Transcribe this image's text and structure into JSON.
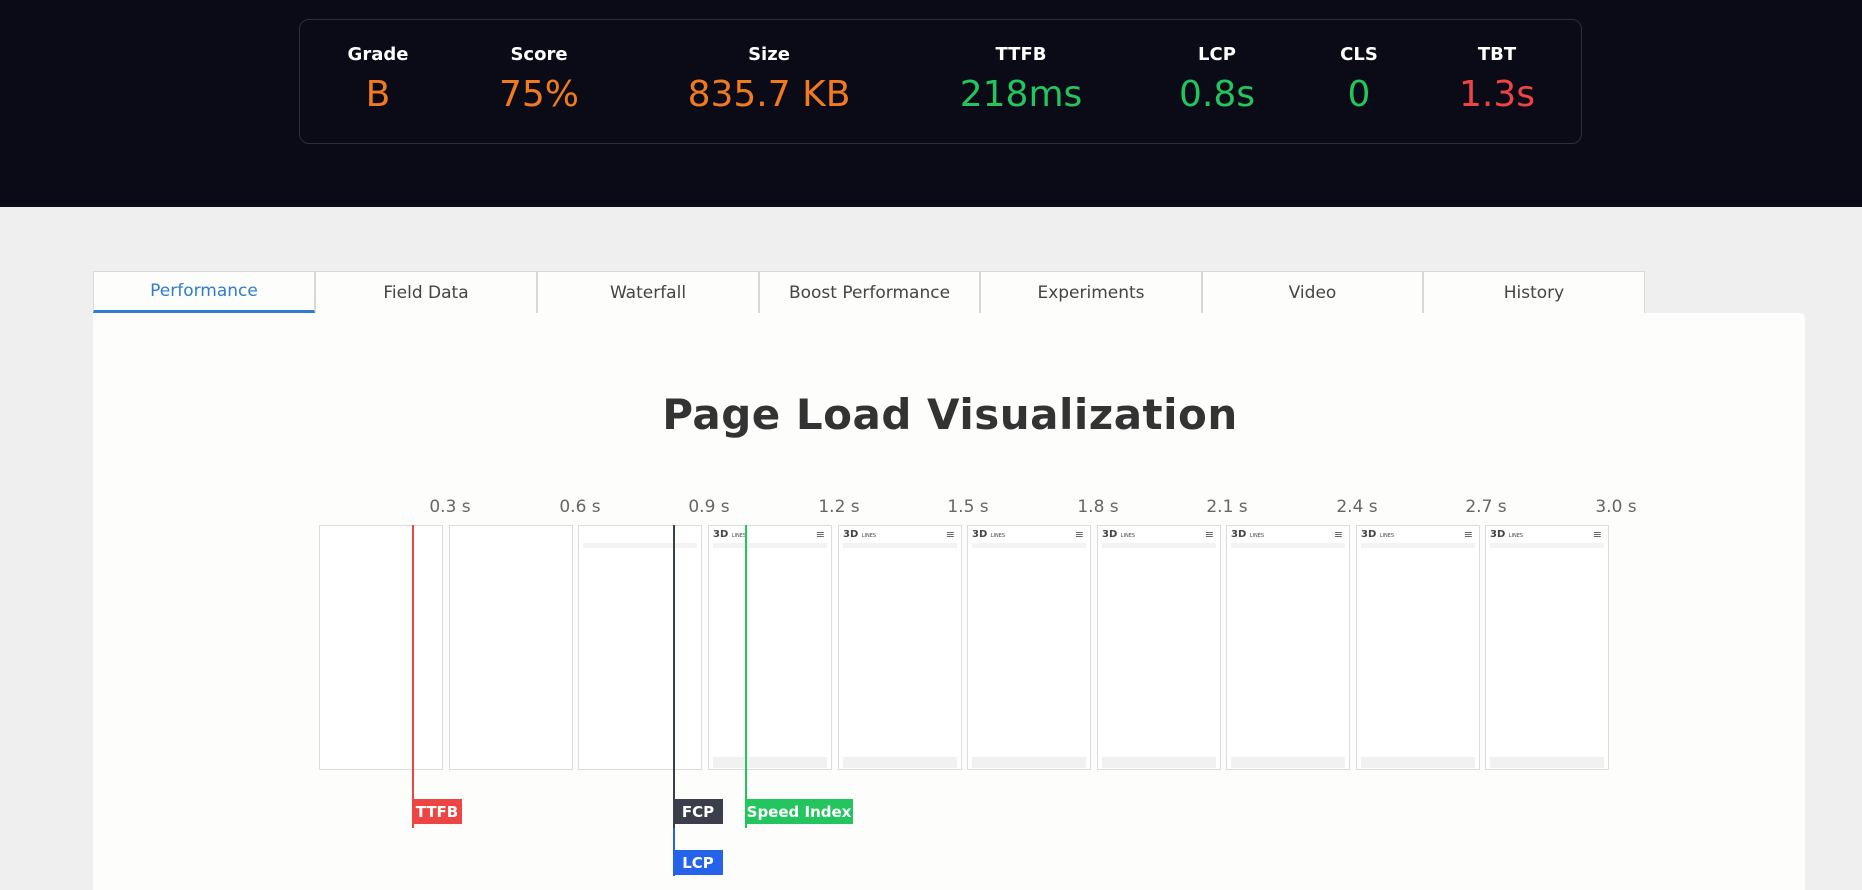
{
  "metrics": {
    "grade": {
      "label": "Grade",
      "value": "B",
      "color": "#f07a1f"
    },
    "score": {
      "label": "Score",
      "value": "75%",
      "color": "#f07a1f"
    },
    "size": {
      "label": "Size",
      "value": "835.7 KB",
      "color": "#f07a1f"
    },
    "ttfb": {
      "label": "TTFB",
      "value": "218ms",
      "color": "#22c55e"
    },
    "lcp": {
      "label": "LCP",
      "value": "0.8s",
      "color": "#22c55e"
    },
    "cls": {
      "label": "CLS",
      "value": "0",
      "color": "#22c55e"
    },
    "tbt": {
      "label": "TBT",
      "value": "1.3s",
      "color": "#ef4444"
    }
  },
  "tabs": [
    "Performance",
    "Field Data",
    "Waterfall",
    "Boost Performance",
    "Experiments",
    "Video",
    "History"
  ],
  "active_tab": "Performance",
  "title": "Page Load Visualization",
  "timeline": {
    "ticks": [
      "0.3 s",
      "0.6 s",
      "0.9 s",
      "1.2 s",
      "1.5 s",
      "1.8 s",
      "2.1 s",
      "2.4 s",
      "2.7 s",
      "3.0 s"
    ],
    "frame_logo": "3D",
    "frame_logo_sub": "LINES",
    "frame_menu_icon": "hamburger-menu-icon",
    "markers": {
      "ttfb": {
        "label": "TTFB",
        "color": "#ef4444"
      },
      "fcp": {
        "label": "FCP",
        "color": "#3a3f4b"
      },
      "speed_index": {
        "label": "Speed Index",
        "color": "#22c55e"
      },
      "lcp": {
        "label": "LCP",
        "color": "#2563eb"
      }
    }
  }
}
